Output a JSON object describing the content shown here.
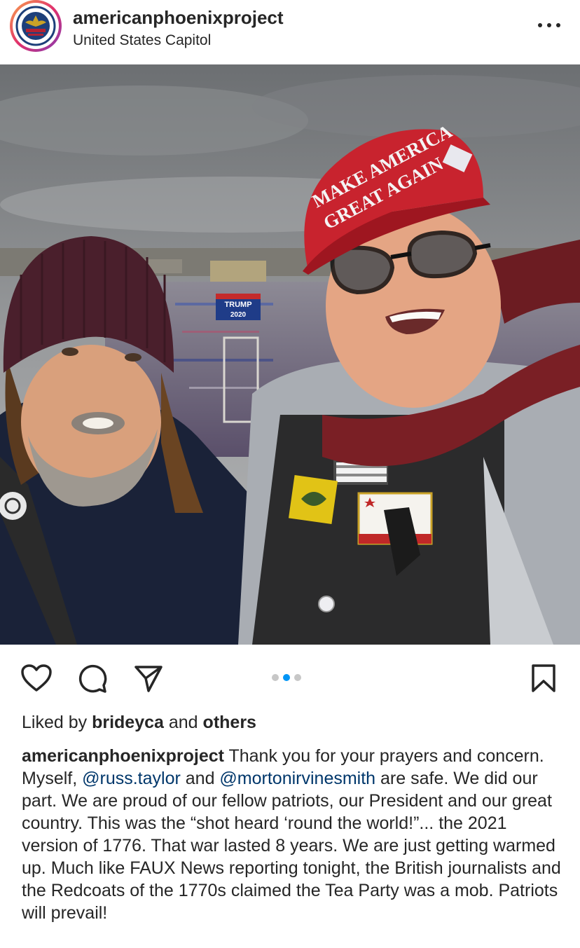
{
  "post": {
    "username": "americanphoenixproject",
    "location": "United States Capitol",
    "photo": {
      "hat_text_line1": "MAKE AMERICA",
      "hat_text_line2": "GREAT AGAIN",
      "banner_text_line1": "TRUMP",
      "banner_text_line2": "2020"
    },
    "carousel": {
      "count": 3,
      "active_index": 1
    },
    "likes": {
      "prefix": "Liked by",
      "user": "brideyca",
      "connector": "and",
      "others": "others"
    },
    "caption": {
      "user": "americanphoenixproject",
      "text_1": " Thank you for your prayers and concern. Myself, ",
      "mention_1": "@russ.taylor",
      "text_2": " and ",
      "mention_2": "@mortonirvinesmith",
      "text_3": " are safe. We did our part. We are proud of our fellow patriots, our President and our great country. This was the “shot heard ‘round the world!”... the 2021 version of 1776. That war lasted 8 years. We are just getting warmed up. Much like FAUX News reporting tonight, the British journalists and the Redcoats of the 1770s claimed the Tea Party was a mob. Patriots will prevail!"
    }
  },
  "icons": {
    "like": "heart-icon",
    "comment": "comment-icon",
    "share": "paper-plane-icon",
    "save": "bookmark-icon",
    "more": "more-dots-icon"
  },
  "colors": {
    "text": "#262626",
    "mention": "#00376b",
    "carousel_active": "#0095f6",
    "carousel_inactive": "#c7c7c7"
  }
}
